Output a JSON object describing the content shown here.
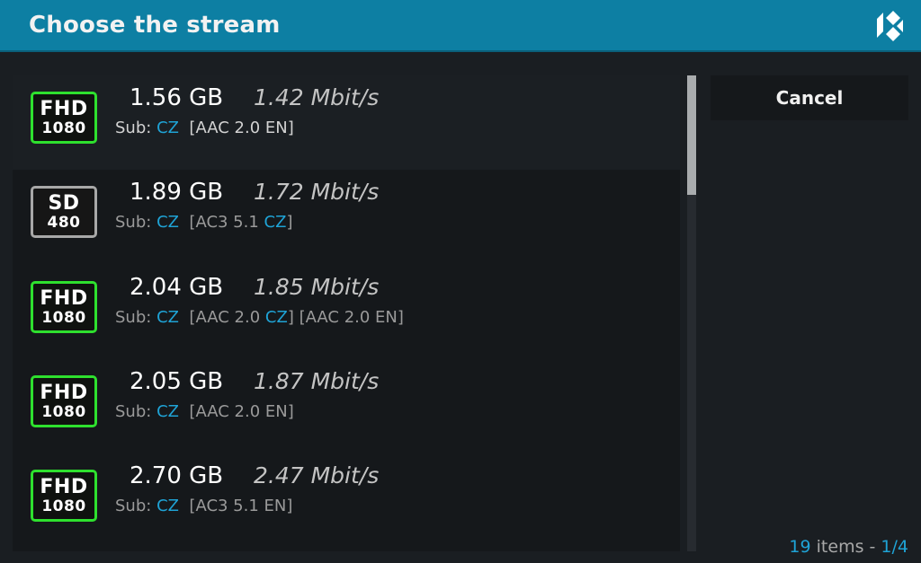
{
  "dialog": {
    "title": "Choose the stream",
    "logo_icon": "kodi-logo-icon",
    "cancel_label": "Cancel"
  },
  "colors": {
    "header_bg": "#0d7fa3",
    "accent": "#1fa3d6",
    "fhd_badge": "#2ee02e",
    "sd_badge": "#a8a8a8"
  },
  "streams": [
    {
      "quality": "FHD",
      "resolution": "1080",
      "size": "1.56 GB",
      "bitrate": "1.42 Mbit/s",
      "sub_label": "Sub:",
      "sub_lang": "CZ",
      "audio_prefix": "[AAC 2.0 EN]",
      "audio_lang": "",
      "audio_suffix": "",
      "audio_extra": ""
    },
    {
      "quality": "SD",
      "resolution": "480",
      "size": "1.89 GB",
      "bitrate": "1.72 Mbit/s",
      "sub_label": "Sub:",
      "sub_lang": "CZ",
      "audio_prefix": "[AC3 5.1 ",
      "audio_lang": "CZ",
      "audio_suffix": "]",
      "audio_extra": ""
    },
    {
      "quality": "FHD",
      "resolution": "1080",
      "size": "2.04 GB",
      "bitrate": "1.85 Mbit/s",
      "sub_label": "Sub:",
      "sub_lang": "CZ",
      "audio_prefix": "[AAC 2.0 ",
      "audio_lang": "CZ",
      "audio_suffix": "]",
      "audio_extra": "[AAC 2.0 EN]"
    },
    {
      "quality": "FHD",
      "resolution": "1080",
      "size": "2.05 GB",
      "bitrate": "1.87 Mbit/s",
      "sub_label": "Sub:",
      "sub_lang": "CZ",
      "audio_prefix": "[AAC 2.0 EN]",
      "audio_lang": "",
      "audio_suffix": "",
      "audio_extra": ""
    },
    {
      "quality": "FHD",
      "resolution": "1080",
      "size": "2.70 GB",
      "bitrate": "2.47 Mbit/s",
      "sub_label": "Sub:",
      "sub_lang": "CZ",
      "audio_prefix": "[AC3 5.1 EN]",
      "audio_lang": "",
      "audio_suffix": "",
      "audio_extra": ""
    }
  ],
  "footer": {
    "count": "19",
    "items_label": " items - ",
    "page": "1/4"
  },
  "scroll": {
    "position_fraction": 0.0,
    "visible_fraction": 0.25
  }
}
